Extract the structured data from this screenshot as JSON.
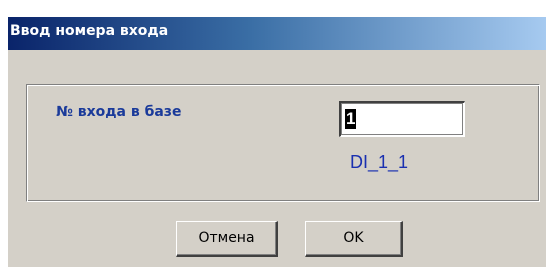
{
  "dialog": {
    "title": "Ввод номера входа"
  },
  "form": {
    "input_label": "№ входа в базе",
    "input_value": "1",
    "code_text": "DI_1_1"
  },
  "buttons": {
    "cancel_label": "Отмена",
    "ok_label": "OK"
  },
  "colors": {
    "titlebar_start": "#0a246a",
    "titlebar_end": "#a6caf0",
    "dialog_background": "#d4d0c8",
    "label_color": "#1a3a9a",
    "code_color": "#1a30b0"
  }
}
